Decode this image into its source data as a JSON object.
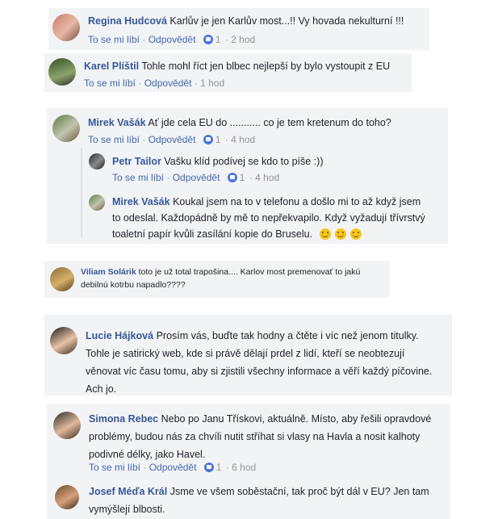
{
  "comments": [
    {
      "name": "Regina Hudcová",
      "text": "Karlův je jen Karlův most...!! Vy hovada nekulturní !!!",
      "like": "To se mi líbí",
      "reply": "Odpovědět",
      "likes": "1",
      "time": "2 hod"
    },
    {
      "name": "Karel Plíštil",
      "text": "Tohle mohl říct jen blbec nejlepší by bylo vystoupit z EU",
      "like": "To se mi líbí",
      "reply": "Odpovědět",
      "time": "1 hod"
    },
    {
      "name": "Mirek Vašák",
      "text": "Ať jde cela EU do ........... co je tem kretenum do toho?",
      "like": "To se mi líbí",
      "reply": "Odpovědět",
      "likes": "1",
      "time": "4 hod"
    },
    {
      "name": "Petr Tailor",
      "text": "Vašku klíd podívej se kdo to píše :))",
      "like": "To se mi líbí",
      "reply": "Odpovědět",
      "likes": "1",
      "time": "4 hod"
    },
    {
      "name": "Mirek Vašák",
      "line1": "Koukal jsem na to v telefonu a došlo mi to až když jsem",
      "line2": "to odeslal. Každopádně by mě to nepřekvapilo. Když vyžadují třívrstvý",
      "line3": "toaletní papír kvůli zasílání kopie do Bruselu."
    },
    {
      "name": "Viliam Solárik",
      "line1": "toto je už total trapošina.... Karlov most premenovať to jakú",
      "line2": "debilnú kotrbu napadlo????"
    },
    {
      "name": "Lucie Hájková",
      "line1": "Prosím vás, buďte tak hodny a čtěte i víc než jenom titulky.",
      "line2": "Tohle je satirický web, kde si právě dělají prdel z lidí, kteří se neobtezují",
      "line3": "věnovat víc času tomu, aby si zjistili všechny informace a věří každý píčovine.",
      "line4": "Ach jo."
    },
    {
      "name": "Simona Rebec",
      "line1": "Nebo po Janu Třískovi, aktuálně. Místo, aby řešili opravdové",
      "line2": "problémy, budou nás za chvíli nutit stříhat si vlasy na Havla a nosit kalhoty",
      "line3": "podivné délky, jako Havel.",
      "like": "To se mi líbí",
      "reply": "Odpovědět",
      "likes": "1",
      "time": "6 hod"
    },
    {
      "name": "Josef Méďa Král",
      "line1": "Jsme ve všem soběstační, tak proč být dál v EU? Jen tam",
      "line2": "vymýšlejí blbosti."
    }
  ],
  "separator": "·"
}
